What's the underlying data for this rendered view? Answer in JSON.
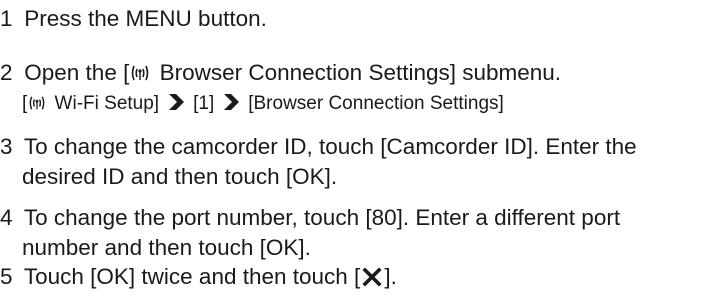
{
  "steps": [
    {
      "num": "1",
      "text": "Press the MENU button."
    },
    {
      "num": "2",
      "line1_pre": "Open the [",
      "line1_post": " Browser Connection Settings] submenu.",
      "sub": {
        "part1_pre": "[",
        "part1_post": " Wi-Fi Setup]",
        "part2": "[1]",
        "part3": "[Browser Connection Settings]"
      }
    },
    {
      "num": "3",
      "line1": "To change the camcorder ID, touch [Camcorder ID]. Enter the",
      "line2": "desired ID and then touch [OK]."
    },
    {
      "num": "4",
      "line1": "To change the port number, touch [80]. Enter a different port",
      "line2": "number and then touch [OK]."
    },
    {
      "num": "5",
      "pre": "Touch [OK] twice and then touch [",
      "post": "]."
    }
  ],
  "icons": {
    "wifi": "wifi-icon",
    "arrow": "arrow-right-icon",
    "close": "close-x-icon"
  }
}
